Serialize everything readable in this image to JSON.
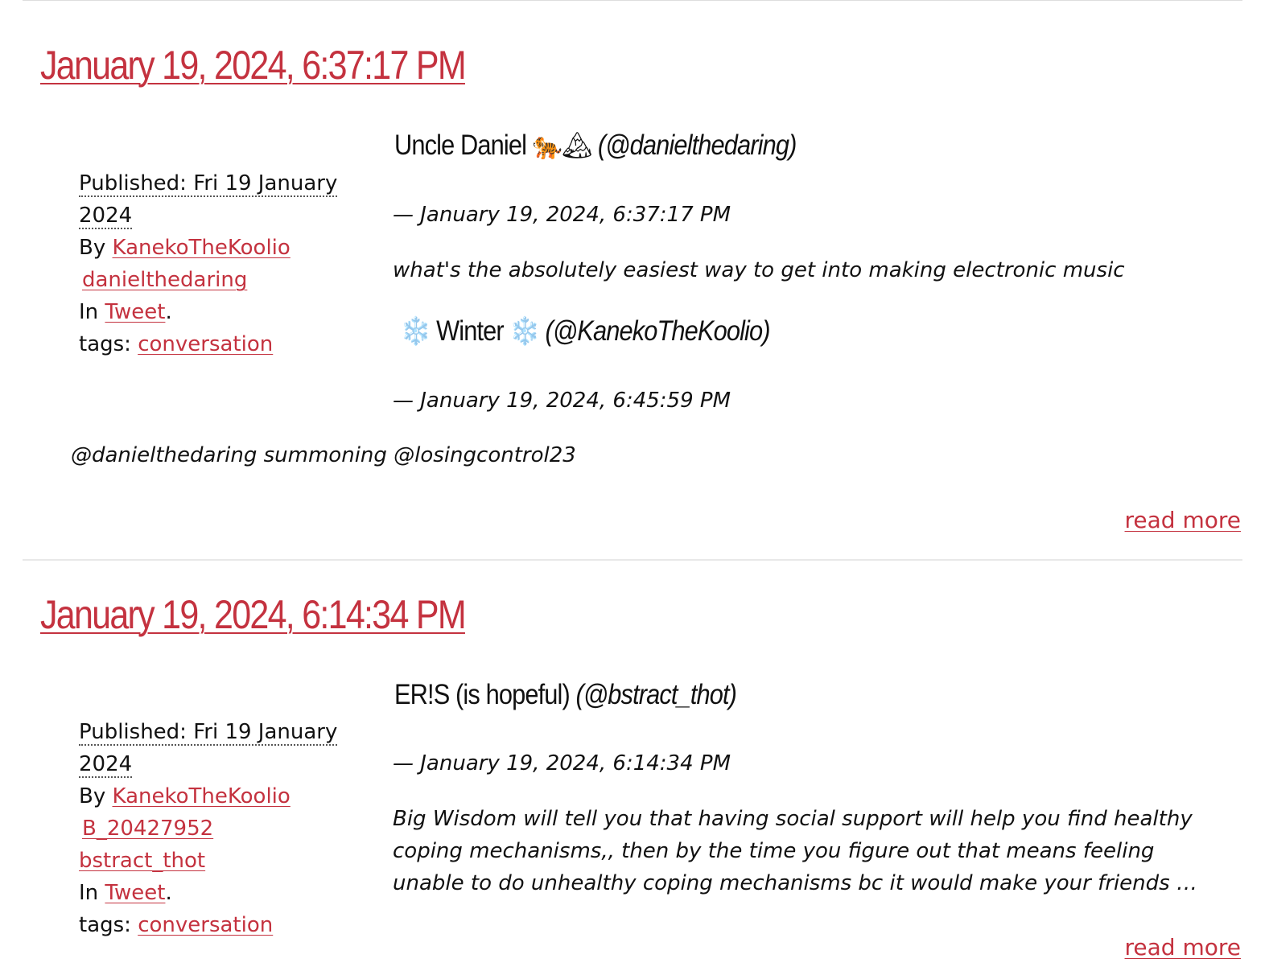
{
  "posts": [
    {
      "title": "January 19, 2024, 6:37:17 PM",
      "meta": {
        "published_label": "Published: Fri 19 January 2024",
        "by_label": "By",
        "authors": [
          "KanekoTheKoolio",
          "danielthedaring"
        ],
        "in_label": "In",
        "category": "Tweet",
        "tags_label": "tags:",
        "tag": "conversation"
      },
      "tweets": [
        {
          "author_name": "Uncle Daniel",
          "author_emoji": "🐅🏔",
          "handle": "(@danielthedaring)",
          "date": "— January 19, 2024, 6:37:17 PM",
          "text": "what's the absolutely easiest way to get into making electronic music"
        },
        {
          "author_prefix_emoji": "❄️",
          "author_name": "Winter",
          "author_suffix_emoji": "❄️",
          "handle": "(@KanekoTheKoolio)",
          "date": "— January 19, 2024, 6:45:59 PM",
          "text": "@danielthedaring summoning @losingcontrol23"
        }
      ],
      "read_more": "read more"
    },
    {
      "title": "January 19, 2024, 6:14:34 PM",
      "meta": {
        "published_label": "Published: Fri 19 January 2024",
        "by_label": "By",
        "authors": [
          "KanekoTheKoolio",
          "B_20427952",
          "bstract_thot"
        ],
        "in_label": "In",
        "category": "Tweet",
        "tags_label": "tags:",
        "tag": "conversation"
      },
      "tweets": [
        {
          "author_name": "ER!S (is hopeful)",
          "handle": "(@bstract_thot)",
          "date": "— January 19, 2024, 6:14:34 PM",
          "text": "Big Wisdom will tell you that having social support will help you find healthy coping mechanisms,, then by the time you figure out that means feeling unable to do unhealthy coping mechanisms bc it would make your friends …"
        }
      ],
      "read_more": "read more"
    }
  ],
  "colors": {
    "link": "#c4323f",
    "text": "#111111",
    "divider": "#e8e8e8"
  }
}
